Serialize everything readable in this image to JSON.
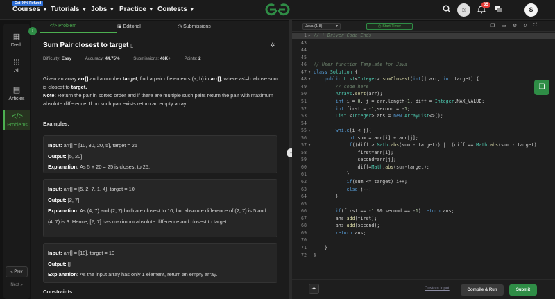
{
  "nav": {
    "badge": "Get 90% Refund",
    "items": [
      "Courses",
      "Tutorials",
      "Jobs",
      "Practice",
      "Contests"
    ],
    "notif_count": "35",
    "avatar_letter": "S",
    "colors": {
      "brand": "#2f8d46"
    }
  },
  "rail": {
    "items": [
      "Dash",
      "All",
      "Articles",
      "Problems"
    ],
    "prev": "« Prev",
    "next": "Next »"
  },
  "tabs": [
    "</> Problem",
    "Editorial",
    "Submissions"
  ],
  "problem": {
    "title": "Sum Pair closest to target",
    "difficulty_label": "Difficulty:",
    "difficulty": "Easy",
    "accuracy_label": "Accuracy:",
    "accuracy": "44.75%",
    "submissions_label": "Submissions:",
    "submissions": "46K+",
    "points_label": "Points:",
    "points": "2",
    "desc_1": "Given an array ",
    "desc_arr": "arr[]",
    "desc_2": " and a number ",
    "desc_target": "target",
    "desc_3": ", find a pair of elements (a, b) in ",
    "desc_arr2": "arr[]",
    "desc_4": ", where a<=b whose sum is closest to ",
    "desc_target2": "target.",
    "note_label": "Note:",
    "note_text": " Return the pair in sorted order and if there are multiple such pairs return the pair with maximum absolute difference. If no such pair exists return an empty array.",
    "examples_heading": "Examples:",
    "examples": [
      {
        "input_label": "Input:",
        "input": " arr[] = [10, 30, 20, 5], target = 25",
        "output_label": "Output:",
        "output": " [5, 20]",
        "expl_label": "Explanation:",
        "expl": " As 5 + 20 = 25 is closest to 25."
      },
      {
        "input_label": "Input:",
        "input": " arr[] = [5, 2, 7, 1, 4], target = 10",
        "output_label": "Output:",
        "output": " [2, 7]",
        "expl_label": "Explanation:",
        "expl": " As (4, 7) and (2, 7) both are closest to 10, but absolute difference of (2, 7) is 5 and (4, 7) is 3. Hence, [2, 7] has maximum absolute difference and closest to target."
      },
      {
        "input_label": "Input:",
        "input": " arr[] = [10], target = 10",
        "output_label": "Output:",
        "output": " []",
        "expl_label": "Explanation:",
        "expl": " As the input array has only 1 element, return an empty array."
      }
    ],
    "constraints_heading": "Constraints:"
  },
  "editor": {
    "language": "Java (1.8)",
    "timer": "Start Timer",
    "custom_input": "Custom Input",
    "compile_run": "Compile & Run",
    "submit": "Submit",
    "lines": [
      {
        "n": "1",
        "fold": "▸",
        "html": "<span class='c'>// } Driver Code Ends</span>"
      },
      {
        "n": "43",
        "fold": "",
        "html": ""
      },
      {
        "n": "44",
        "fold": "",
        "html": ""
      },
      {
        "n": "45",
        "fold": "",
        "html": ""
      },
      {
        "n": "46",
        "fold": "",
        "html": "<span class='c'>// User function Template for Java</span>"
      },
      {
        "n": "47",
        "fold": "▾",
        "html": "<span class='k'>class</span> <span class='t'>Solution</span> {"
      },
      {
        "n": "48",
        "fold": "▾",
        "html": "    <span class='k'>public</span> <span class='t'>List</span>&lt;<span class='t'>Integer</span>&gt; <span class='f'>sumClosest</span>(<span class='k'>int</span>[] arr, <span class='k'>int</span> target) {"
      },
      {
        "n": "49",
        "fold": "",
        "html": "        <span class='c'>// code here</span>"
      },
      {
        "n": "50",
        "fold": "",
        "html": "        <span class='t'>Arrays</span>.<span class='f'>sort</span>(arr);"
      },
      {
        "n": "51",
        "fold": "",
        "html": "        <span class='k'>int</span> i = <span class='n'>0</span>, j = arr.length-<span class='n'>1</span>, diff = <span class='t'>Integer</span>.MAX_VALUE;"
      },
      {
        "n": "52",
        "fold": "",
        "html": "        <span class='k'>int</span> first = -<span class='n'>1</span>,second = -<span class='n'>1</span>;"
      },
      {
        "n": "53",
        "fold": "",
        "html": "        <span class='t'>List</span> &lt;<span class='t'>Integer</span>&gt; ans = <span class='k'>new</span> <span class='t'>ArrayList</span>&lt;&gt;();"
      },
      {
        "n": "54",
        "fold": "",
        "html": ""
      },
      {
        "n": "55",
        "fold": "▾",
        "html": "        <span class='k'>while</span>(i &lt; j){"
      },
      {
        "n": "56",
        "fold": "",
        "html": "            <span class='k'>int</span> sum = arr[i] + arr[j];"
      },
      {
        "n": "57",
        "fold": "▾",
        "html": "            <span class='k'>if</span>((diff &gt; <span class='t'>Math</span>.<span class='f'>abs</span>(sum - target)) || (diff == <span class='t'>Math</span>.<span class='f'>abs</span>(sum - target)"
      },
      {
        "n": "58",
        "fold": "",
        "html": "                first=arr[i];"
      },
      {
        "n": "59",
        "fold": "",
        "html": "                second=arr[j];"
      },
      {
        "n": "60",
        "fold": "",
        "html": "                diff=<span class='t'>Math</span>.<span class='f'>abs</span>(sum-target);"
      },
      {
        "n": "61",
        "fold": "",
        "html": "            }"
      },
      {
        "n": "62",
        "fold": "",
        "html": "            <span class='k'>if</span>(sum &lt;= target) i++;"
      },
      {
        "n": "63",
        "fold": "",
        "html": "            <span class='k'>else</span> j--;"
      },
      {
        "n": "64",
        "fold": "",
        "html": "        }"
      },
      {
        "n": "65",
        "fold": "",
        "html": ""
      },
      {
        "n": "66",
        "fold": "",
        "html": "        <span class='k'>if</span>(first == -<span class='n'>1</span> &amp;&amp; second == -<span class='n'>1</span>) <span class='k'>return</span> ans;"
      },
      {
        "n": "67",
        "fold": "",
        "html": "        ans.<span class='f'>add</span>(first);"
      },
      {
        "n": "68",
        "fold": "",
        "html": "        ans.<span class='f'>add</span>(second);"
      },
      {
        "n": "69",
        "fold": "",
        "html": "        <span class='k'>return</span> ans;"
      },
      {
        "n": "70",
        "fold": "",
        "html": ""
      },
      {
        "n": "71",
        "fold": "",
        "html": "    }"
      },
      {
        "n": "72",
        "fold": "",
        "html": "}"
      }
    ]
  }
}
